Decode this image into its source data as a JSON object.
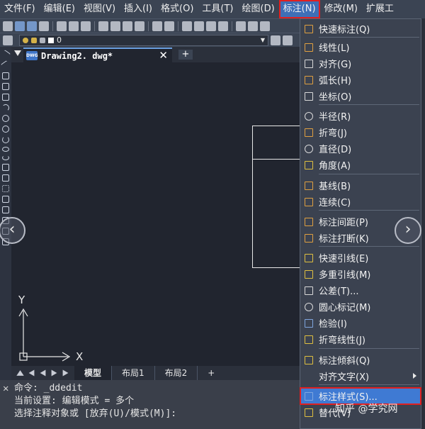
{
  "menubar": {
    "items": [
      "文件(F)",
      "编辑(E)",
      "视图(V)",
      "插入(I)",
      "格式(O)",
      "工具(T)",
      "绘图(D)",
      "标注(N)",
      "修改(M)",
      "扩展工"
    ],
    "active_index": 7
  },
  "layer": {
    "name": "0"
  },
  "document": {
    "icon_text": "DWG",
    "tab_title": "Drawing2. dwg*",
    "close": "✕",
    "new_tab": "+"
  },
  "ucs": {
    "y_label": "Y",
    "x_label": "X"
  },
  "layout_tabs": [
    "模型",
    "布局1",
    "布局2",
    "+"
  ],
  "command_line": {
    "close": "✕",
    "lines": [
      "命令: _ddedit",
      "当前设置: 编辑模式 = 多个",
      "选择注释对象或 [放弃(U)/模式(M)]:"
    ]
  },
  "dropdown": {
    "items": [
      {
        "label": "快速标注(Q)",
        "icon": "quick-dimension-icon"
      },
      {
        "label": "线性(L)",
        "icon": "linear-dimension-icon"
      },
      {
        "label": "对齐(G)",
        "icon": "aligned-dimension-icon"
      },
      {
        "label": "弧长(H)",
        "icon": "arc-length-icon"
      },
      {
        "label": "坐标(O)",
        "icon": "ordinate-dimension-icon"
      },
      {
        "label": "半径(R)",
        "icon": "radius-dimension-icon"
      },
      {
        "label": "折弯(J)",
        "icon": "jogged-dimension-icon"
      },
      {
        "label": "直径(D)",
        "icon": "diameter-dimension-icon"
      },
      {
        "label": "角度(A)",
        "icon": "angular-dimension-icon"
      },
      {
        "label": "基线(B)",
        "icon": "baseline-dimension-icon"
      },
      {
        "label": "连续(C)",
        "icon": "continue-dimension-icon"
      },
      {
        "label": "标注间距(P)",
        "icon": "dimension-space-icon"
      },
      {
        "label": "标注打断(K)",
        "icon": "dimension-break-icon"
      },
      {
        "label": "快速引线(E)",
        "icon": "quick-leader-icon"
      },
      {
        "label": "多重引线(M)",
        "icon": "multileader-icon"
      },
      {
        "label": "公差(T)...",
        "icon": "tolerance-icon"
      },
      {
        "label": "圆心标记(M)",
        "icon": "center-mark-icon"
      },
      {
        "label": "检验(I)",
        "icon": "inspection-icon"
      },
      {
        "label": "折弯线性(J)",
        "icon": "jogged-linear-icon"
      },
      {
        "label": "标注倾斜(Q)",
        "icon": "oblique-icon"
      },
      {
        "label": "对齐文字(X)",
        "icon": ""
      },
      {
        "label": "标注样式(S)...",
        "icon": "dimension-style-icon"
      },
      {
        "label": "替代(V)",
        "icon": "override-icon"
      }
    ],
    "highlight_index": 21
  },
  "watermark": "知乎 @学究网"
}
